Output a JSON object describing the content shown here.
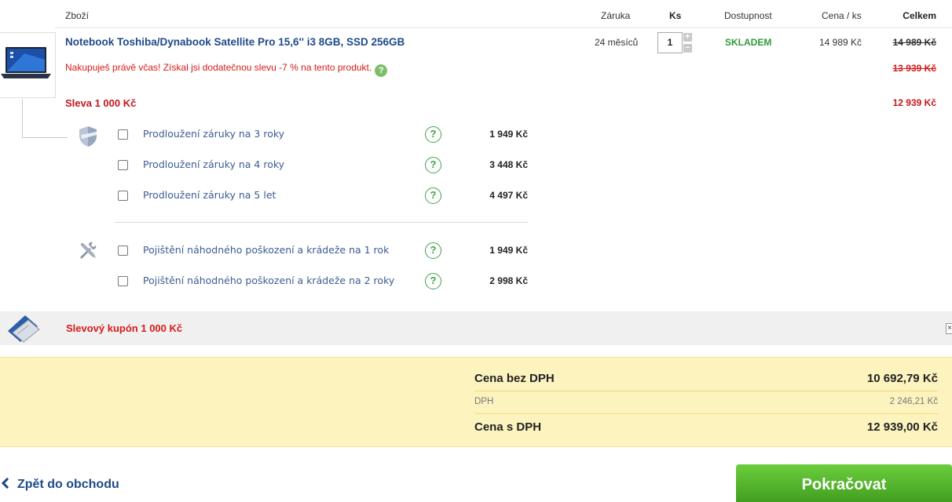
{
  "header": {
    "col_goods": "Zboží",
    "col_warranty": "Záruka",
    "col_qty": "Ks",
    "col_availability": "Dostupnost",
    "col_unit_price": "Cena / ks",
    "col_total": "Celkem"
  },
  "product": {
    "name": "Notebook Toshiba/Dynabook Satellite Pro 15,6'' i3 8GB, SSD 256GB",
    "promo": "Nakupuješ právě včas! Získal jsi dodatečnou slevu -7 % na tento produkt.",
    "promo_help": "?",
    "warranty": "24 měsíců",
    "qty": "1",
    "qty_plus": "+",
    "qty_minus": "−",
    "availability": "SKLADEM",
    "unit_price": "14 989 Kč",
    "total_original": "14 989 Kč",
    "total_after_promo": "13 939 Kč",
    "discount_label": "Sleva 1 000 Kč",
    "discount_total": "12 939 Kč"
  },
  "warranty_options": [
    {
      "label": "Prodloužení záruky na 3 roky",
      "price": "1 949 Kč",
      "help": "?"
    },
    {
      "label": "Prodloužení záruky na 4 roky",
      "price": "3 448 Kč",
      "help": "?"
    },
    {
      "label": "Prodloužení záruky na 5 let",
      "price": "4 497 Kč",
      "help": "?"
    }
  ],
  "insurance_options": [
    {
      "label": "Pojištění náhodného poškození a krádeže na 1 rok",
      "price": "1 949 Kč",
      "help": "?"
    },
    {
      "label": "Pojištění náhodného poškození a krádeže na 2 roky",
      "price": "2 998 Kč",
      "help": "?"
    }
  ],
  "coupon": {
    "label": "Slevový kupón 1 000 Kč",
    "close": "×"
  },
  "summary": {
    "without_vat_label": "Cena bez DPH",
    "without_vat_value": "10 692,79 Kč",
    "vat_label": "DPH",
    "vat_value": "2 246,21 Kč",
    "with_vat_label": "Cena s DPH",
    "with_vat_value": "12 939,00 Kč"
  },
  "footer": {
    "back_label": "Zpět do obchodu",
    "continue_label": "Pokračovat"
  },
  "colors": {
    "link_blue": "#1f4a8a",
    "alert_red": "#d71a1a",
    "stock_green": "#2f9a3a",
    "summary_bg": "#fdf3bf",
    "continue_green": "#4faf29"
  }
}
